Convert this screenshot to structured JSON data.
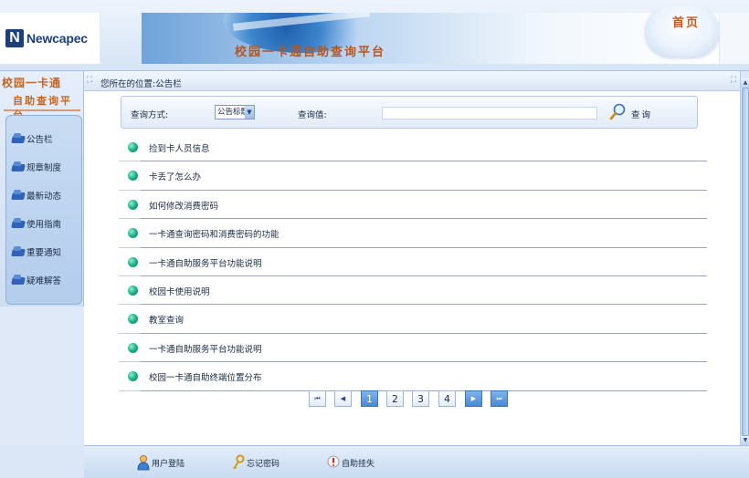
{
  "header": {
    "logo_text": "Newcapec",
    "logo_mark": "N",
    "banner_title": "校园一卡通自助查询平台",
    "home_label": "首页"
  },
  "sidebar": {
    "title_line1": "校园一卡通",
    "title_line2": "自助查询平台",
    "items": [
      {
        "label": "公告栏",
        "icon": "folder-icon"
      },
      {
        "label": "规章制度",
        "icon": "folder-icon"
      },
      {
        "label": "最新动态",
        "icon": "folder-icon"
      },
      {
        "label": "使用指南",
        "icon": "folder-icon"
      },
      {
        "label": "重要通知",
        "icon": "folder-icon"
      },
      {
        "label": "疑难解答",
        "icon": "folder-icon"
      }
    ]
  },
  "breadcrumb": {
    "text": "您所在的位置:公告栏"
  },
  "search": {
    "mode_label": "查询方式:",
    "mode_value": "公告标题",
    "value_label": "查询值:",
    "value": "",
    "button_label": "查询"
  },
  "notices": [
    {
      "title": "捡到卡人员信息"
    },
    {
      "title": "卡丢了怎么办"
    },
    {
      "title": "如何修改消费密码"
    },
    {
      "title": "一卡通查询密码和消费密码的功能"
    },
    {
      "title": "一卡通自助服务平台功能说明"
    },
    {
      "title": "校园卡使用说明"
    },
    {
      "title": "教室查询"
    },
    {
      "title": "一卡通自助服务平台功能说明"
    },
    {
      "title": "校园一卡通自助终端位置分布"
    }
  ],
  "pager": {
    "first": "⏮",
    "prev": "◀",
    "pages": [
      "1",
      "2",
      "3",
      "4"
    ],
    "current_page": "1",
    "next": "▶",
    "last": "⏭"
  },
  "footer": {
    "items": [
      {
        "label": "用户登陆",
        "icon": "user-icon"
      },
      {
        "label": "忘记密码",
        "icon": "key-icon"
      },
      {
        "label": "自助挂失",
        "icon": "alert-icon"
      }
    ]
  },
  "colors": {
    "accent_orange": "#c4651f",
    "accent_blue": "#4a88d4",
    "bullet_green": "#1bb088"
  }
}
